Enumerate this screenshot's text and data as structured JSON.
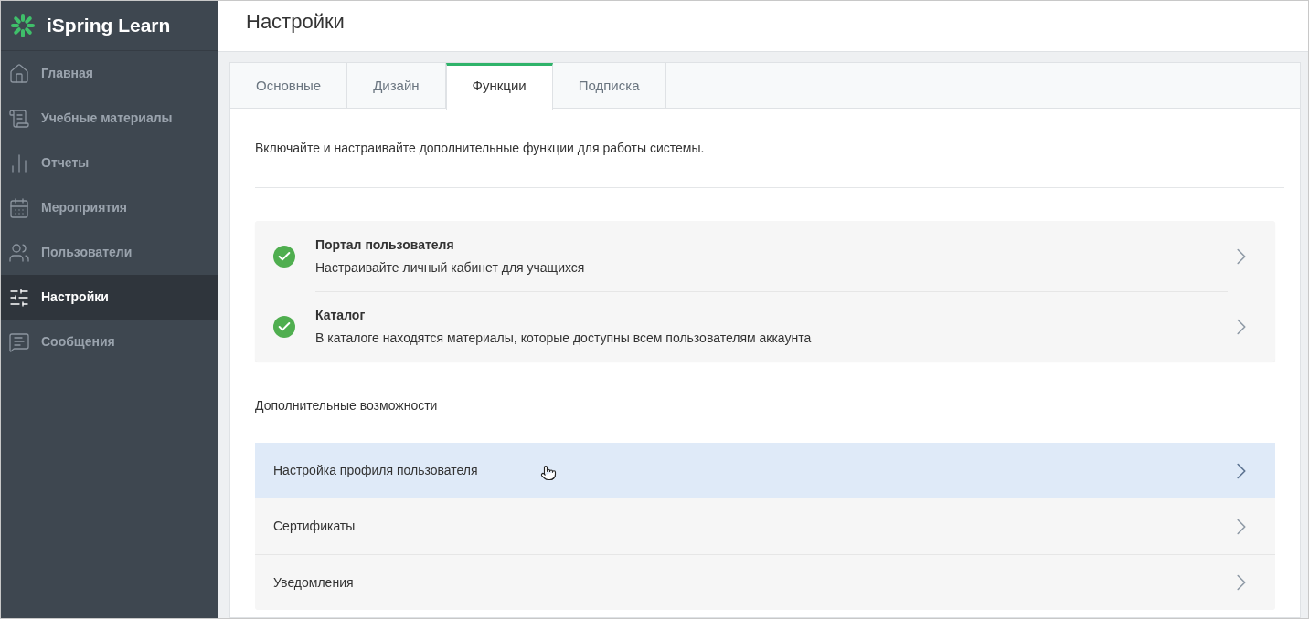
{
  "sidebar": {
    "logo": "iSpring Learn",
    "items": [
      {
        "label": "Главная",
        "selected": false
      },
      {
        "label": "Учебные материалы",
        "selected": false
      },
      {
        "label": "Отчеты",
        "selected": false
      },
      {
        "label": "Мероприятия",
        "selected": false
      },
      {
        "label": "Пользователи",
        "selected": false
      },
      {
        "label": "Настройки",
        "selected": true
      },
      {
        "label": "Сообщения",
        "selected": false
      }
    ]
  },
  "page": {
    "title": "Настройки",
    "tabs": [
      {
        "label": "Основные",
        "selected": false
      },
      {
        "label": "Дизайн",
        "selected": false
      },
      {
        "label": "Функции",
        "selected": true
      },
      {
        "label": "Подписка",
        "selected": false
      }
    ],
    "intro": "Включайте и настраивайте дополнительные функции для работы системы.",
    "features": [
      {
        "title": "Портал пользователя",
        "description": "Настраивайте личный кабинет для учащихся",
        "enabled": true
      },
      {
        "title": "Каталог",
        "description": "В каталоге находятся материалы, которые доступны всем пользователям аккаунта",
        "enabled": true
      }
    ],
    "extras_heading": "Дополнительные возможности",
    "extras": [
      {
        "label": "Настройка профиля пользователя",
        "highlighted": true
      },
      {
        "label": "Сертификаты",
        "highlighted": false
      },
      {
        "label": "Уведомления",
        "highlighted": false
      }
    ]
  }
}
